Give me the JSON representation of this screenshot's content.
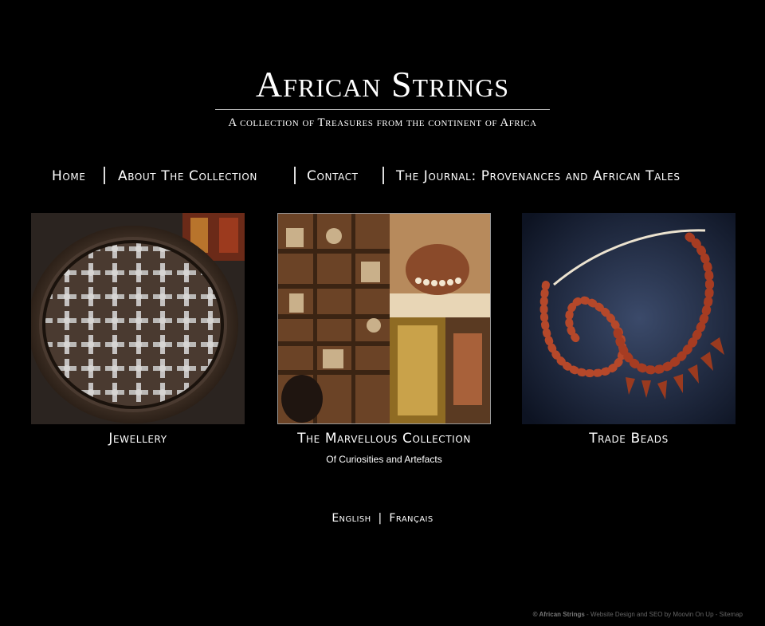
{
  "header": {
    "title": "African Strings",
    "tagline": "A collection of Treasures from the continent of Africa"
  },
  "nav": {
    "items": [
      {
        "label": "Home"
      },
      {
        "label": "About The Collection"
      },
      {
        "label": "Contact"
      },
      {
        "label": "The Journal: Provenances and African Tales"
      }
    ]
  },
  "tiles": [
    {
      "caption": "Jewellery",
      "image": "silver-crosses-tray"
    },
    {
      "caption": "The Marvellous Collection",
      "subcaption": "Of Curiosities and Artefacts",
      "image": "cabinet-of-curiosities"
    },
    {
      "caption": "Trade Beads",
      "image": "red-bead-necklaces"
    }
  ],
  "languages": {
    "english": "English",
    "separator": "|",
    "french": "Français"
  },
  "footer": {
    "brand": "© African Strings",
    "text": " - Website Design and SEO by Moovin On Up - Sitemap"
  },
  "colors": {
    "background": "#000000",
    "text": "#ffffff",
    "footer": "#666666"
  }
}
